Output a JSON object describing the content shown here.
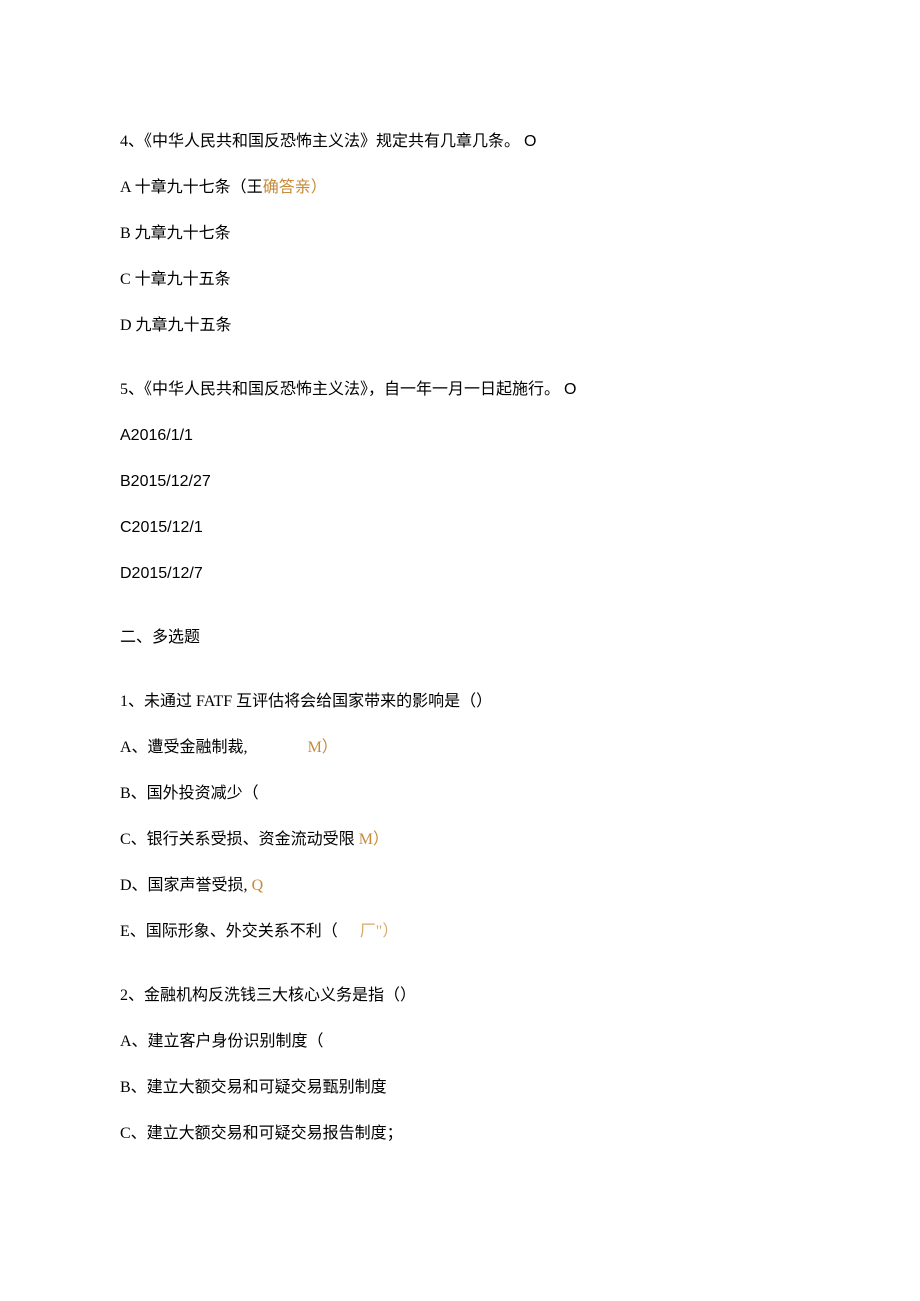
{
  "q4": {
    "stem_prefix": "4、《中华人民共和国反恐怖主义法》规定共有几章几条。",
    "stem_suffix": "O",
    "a_prefix": "A 十章九十七条（王",
    "a_annot": "确答亲）",
    "b": "B 九章九十七条",
    "c": "C 十章九十五条",
    "d": "D 九章九十五条"
  },
  "q5": {
    "stem_prefix": "5、《中华人民共和国反恐怖主义法》，自一年一月一日起施行。",
    "stem_suffix": "O",
    "a": "A2016/1/1",
    "b": "B2015/12/27",
    "c": "C2015/12/1",
    "d": "D2015/12/7"
  },
  "section2": "二、多选题",
  "mq1": {
    "stem": "1、未通过 FATF 互评估将会给国家带来的影响是（）",
    "a_text": "A、遭受金融制裁,",
    "a_annot": "M）",
    "b": "B、国外投资减少（",
    "c_text": "C、银行关系受损、资金流动受限 ",
    "c_annot": "M）",
    "d_text": "D、国家声誉受损, ",
    "d_annot": "Q",
    "e_text": "E、国际形象、外交关系不利（",
    "e_annot": "厂\"）"
  },
  "mq2": {
    "stem": "2、金融机构反洗钱三大核心义务是指（）",
    "a": "A、建立客户身份识别制度（",
    "b": "B、建立大额交易和可疑交易甄别制度",
    "c": "C、建立大额交易和可疑交易报告制度；"
  }
}
